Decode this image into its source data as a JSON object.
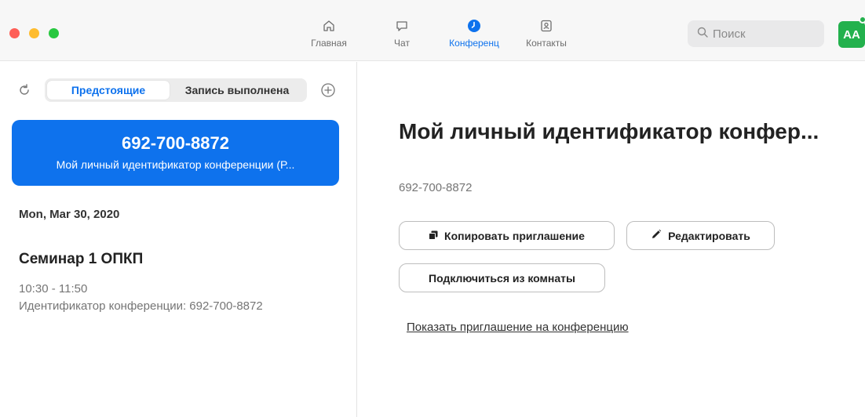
{
  "nav": {
    "tabs": [
      {
        "label": "Главная",
        "icon": "home-icon",
        "active": false
      },
      {
        "label": "Чат",
        "icon": "chat-icon",
        "active": false
      },
      {
        "label": "Конференц",
        "icon": "clock-icon",
        "active": true
      },
      {
        "label": "Контакты",
        "icon": "contacts-icon",
        "active": false
      }
    ],
    "search_placeholder": "Поиск",
    "avatar_initials": "AA"
  },
  "sidebar": {
    "segments": [
      "Предстоящие",
      "Запись выполнена"
    ],
    "pmi_card": {
      "number": "692-700-8872",
      "title": "Мой личный идентификатор конференции (Р..."
    },
    "date_heading": "Mon, Mar 30, 2020",
    "meeting": {
      "title": "Семинар 1 ОПКП",
      "time": "10:30 - 11:50",
      "id_line": "Идентификатор конференции: 692-700-8872"
    }
  },
  "detail": {
    "title": "Мой личный идентификатор конфер...",
    "id": "692-700-8872",
    "copy_label": "Копировать приглашение",
    "edit_label": "Редактировать",
    "room_label": "Подключиться из комнаты",
    "invite_link": "Показать приглашение на конференцию"
  },
  "colors": {
    "accent": "#0e72ed",
    "avatar": "#23b14d",
    "close": "#fe5f57",
    "minimize": "#febc2e",
    "maximize": "#28c840"
  }
}
